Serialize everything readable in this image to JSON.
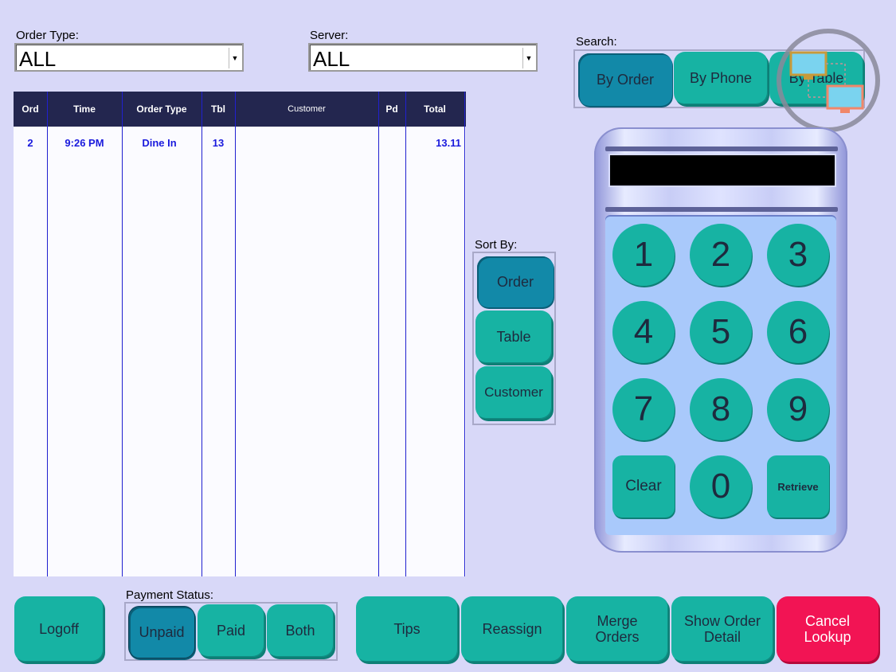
{
  "filters": {
    "order_type_label": "Order Type:",
    "order_type_value": "ALL",
    "server_label": "Server:",
    "server_value": "ALL"
  },
  "search": {
    "label": "Search:",
    "buttons": [
      "By Order",
      "By Phone",
      "By Table"
    ],
    "selected": "By Order"
  },
  "table": {
    "columns": [
      "Ord",
      "Time",
      "Order Type",
      "Tbl",
      "Customer",
      "Pd",
      "Total"
    ],
    "rows": [
      {
        "ord": "2",
        "time": "9:26 PM",
        "order_type": "Dine In",
        "tbl": "13",
        "customer": "",
        "pd": "",
        "total": "13.11"
      }
    ]
  },
  "sort": {
    "label": "Sort By:",
    "buttons": [
      "Order",
      "Table",
      "Customer"
    ],
    "selected": "Order"
  },
  "keypad": {
    "display": "",
    "keys": [
      "1",
      "2",
      "3",
      "4",
      "5",
      "6",
      "7",
      "8",
      "9",
      "0"
    ],
    "clear_label": "Clear",
    "retrieve_label": "Retrieve"
  },
  "payment_status": {
    "label": "Payment Status:",
    "buttons": [
      "Unpaid",
      "Paid",
      "Both"
    ],
    "selected": "Unpaid"
  },
  "footer": {
    "logoff": "Logoff",
    "tips": "Tips",
    "reassign": "Reassign",
    "merge_orders": "Merge\nOrders",
    "show_order_detail": "Show Order\nDetail",
    "cancel_lookup": "Cancel\nLookup"
  },
  "colors": {
    "background": "#d8d8f8",
    "button": "#17b3a3",
    "button_selected": "#1289a8",
    "cancel": "#f21454",
    "table_header": "#23264f",
    "table_text": "#1a1add"
  },
  "icons": [
    "network-computers-icon"
  ]
}
